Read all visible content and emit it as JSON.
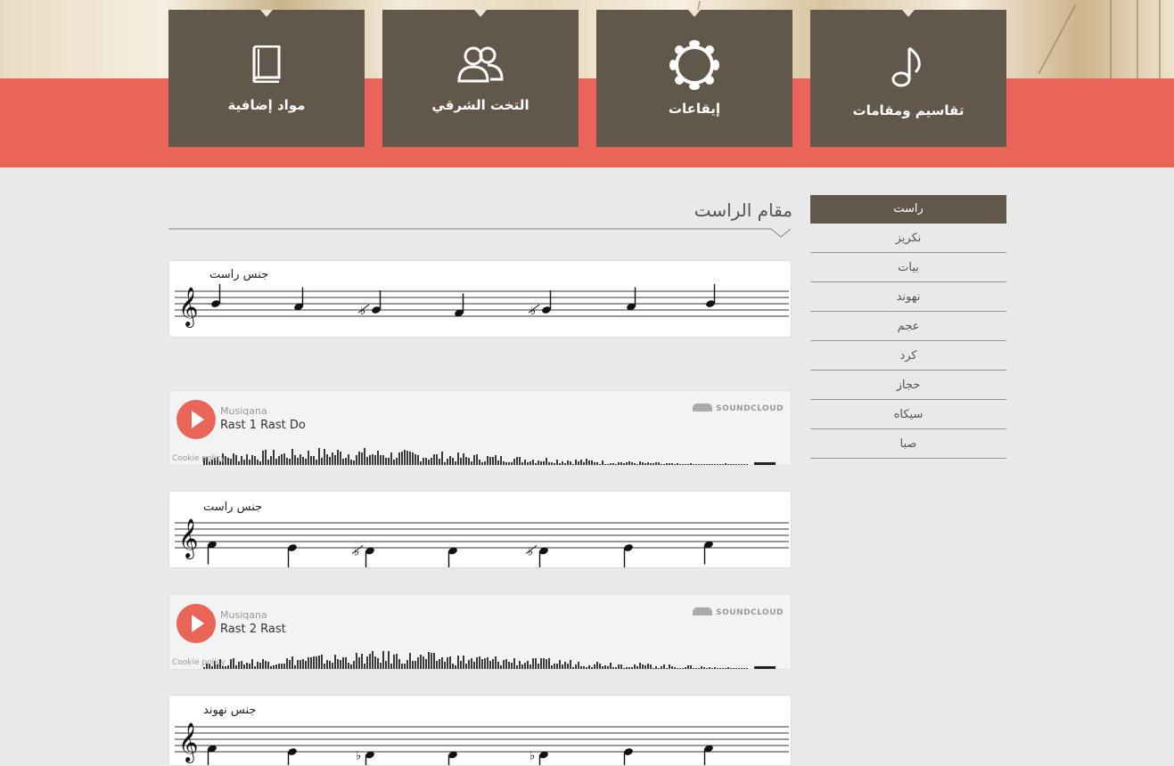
{
  "nav": {
    "tiles": [
      {
        "label": "تقاسيم ومقامات",
        "icon": "music-note-icon"
      },
      {
        "label": "إيقاعات",
        "icon": "tambourine-icon"
      },
      {
        "label": "التخت الشرقي",
        "icon": "users-icon"
      },
      {
        "label": "مواد إضافية",
        "icon": "book-icon"
      }
    ]
  },
  "main": {
    "title": "مقام الراست",
    "notations": [
      {
        "label": "جنس راست"
      },
      {
        "label": "جنس راست"
      },
      {
        "label": "جنس نهوند"
      }
    ],
    "players": [
      {
        "artist": "Musiqana",
        "title": "Rast 1 Rast Do",
        "brand": "SOUNDCLOUD",
        "cookie": "Cookie policy"
      },
      {
        "artist": "Musiqana",
        "title": "Rast 2 Rast",
        "brand": "SOUNDCLOUD",
        "cookie": "Cookie policy"
      }
    ]
  },
  "sidebar": {
    "items": [
      {
        "label": "راست",
        "active": true
      },
      {
        "label": "نكريز"
      },
      {
        "label": "بيات"
      },
      {
        "label": "نهوند"
      },
      {
        "label": "عجم"
      },
      {
        "label": "كرد"
      },
      {
        "label": "حجاز"
      },
      {
        "label": "سيكاه"
      },
      {
        "label": "صبا"
      }
    ]
  },
  "colors": {
    "accent": "#e96557",
    "tile": "#62574b",
    "background": "#e9e9e9"
  }
}
